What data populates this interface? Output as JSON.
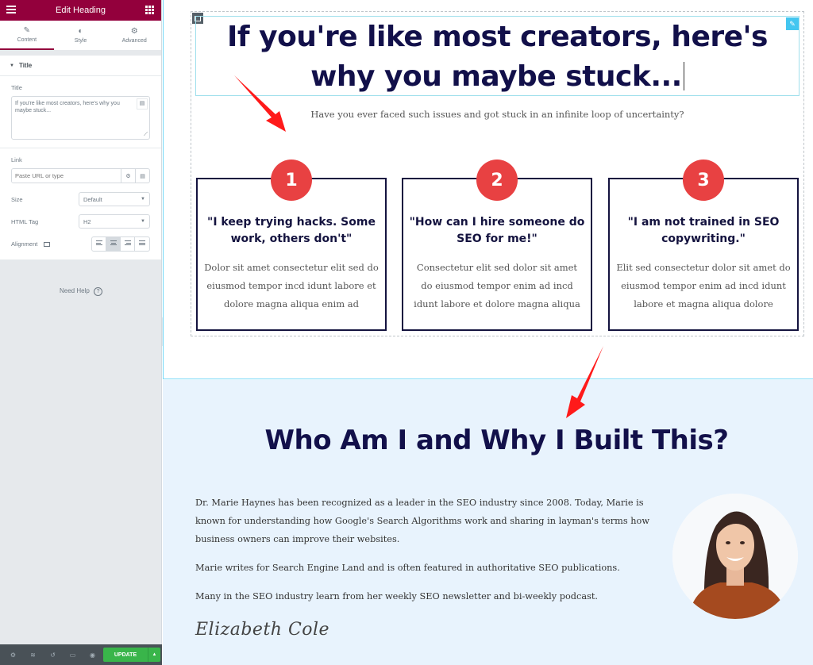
{
  "sidebar": {
    "header_title": "Edit Heading",
    "tabs": [
      {
        "label": "Content",
        "icon": "pencil-icon",
        "active": true
      },
      {
        "label": "Style",
        "icon": "contrast-icon",
        "active": false
      },
      {
        "label": "Advanced",
        "icon": "gear-icon",
        "active": false
      }
    ],
    "section_title": "Title",
    "title_label": "Title",
    "title_value": "If you're like most creators, here's why you maybe stuck...",
    "link_label": "Link",
    "link_placeholder": "Paste URL or type",
    "size_label": "Size",
    "size_value": "Default",
    "html_tag_label": "HTML Tag",
    "html_tag_value": "H2",
    "alignment_label": "Alignment",
    "alignment_options": [
      "left",
      "center",
      "right",
      "justify"
    ],
    "alignment_selected": "center",
    "need_help": "Need Help",
    "footer": {
      "icons": [
        "settings-icon",
        "layers-icon",
        "history-icon",
        "responsive-icon",
        "preview-icon"
      ],
      "update_label": "UPDATE"
    }
  },
  "canvas": {
    "main_heading": "If you're like most creators, here's why you maybe stuck...",
    "subtitle": "Have you ever faced such issues and got stuck in an infinite loop of uncertainty?",
    "cards": [
      {
        "number": "1",
        "title": "\"I keep trying hacks. Some work, others don't\"",
        "body": "Dolor sit amet consectetur elit sed do eiusmod tempor incd idunt labore et dolore magna aliqua enim ad"
      },
      {
        "number": "2",
        "title": "\"How can I hire someone do SEO for me!\"",
        "body": "Consectetur elit sed dolor sit amet do eiusmod tempor enim ad incd idunt labore et dolore magna aliqua"
      },
      {
        "number": "3",
        "title": "\"I am not trained in SEO copywriting.\"",
        "body": "Elit sed consectetur dolor sit amet do eiusmod tempor enim ad incd idunt labore et magna aliqua dolore"
      }
    ],
    "about": {
      "heading": "Who Am I and Why I Built This?",
      "paragraphs": [
        "Dr. Marie Haynes has been recognized as a leader in the SEO industry since 2008. Today, Marie is known for understanding how Google's Search Algorithms work and sharing in layman's terms how business owners can improve their websites.",
        "Marie writes for Search Engine Land and is often featured in authoritative SEO publications.",
        "Many in the SEO industry learn from her weekly SEO newsletter and bi-weekly podcast."
      ],
      "signature": "Elizabeth Cole"
    }
  },
  "colors": {
    "brand": "#93003c",
    "heading": "#12104a",
    "badge": "#e84142",
    "update": "#39b54a",
    "about_bg": "#e8f3fd",
    "annotation_arrow": "#ff1a1a"
  }
}
